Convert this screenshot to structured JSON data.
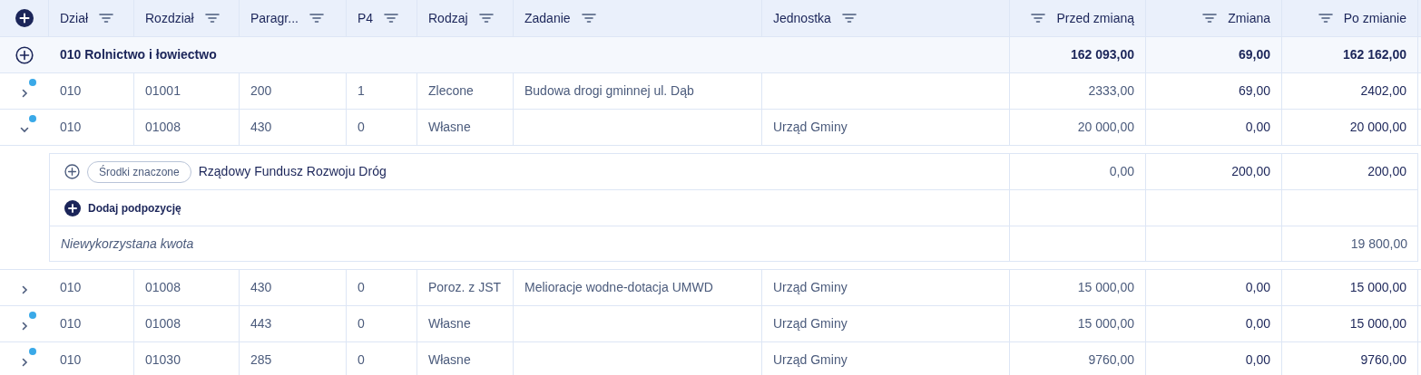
{
  "columns": [
    {
      "label": "Dział",
      "kind": "text"
    },
    {
      "label": "Rozdział",
      "kind": "text"
    },
    {
      "label": "Paragr...",
      "kind": "text"
    },
    {
      "label": "P4",
      "kind": "text"
    },
    {
      "label": "Rodzaj",
      "kind": "text"
    },
    {
      "label": "Zadanie",
      "kind": "text"
    },
    {
      "label": "Jednostka",
      "kind": "text"
    },
    {
      "label": "Przed zmianą",
      "kind": "amount"
    },
    {
      "label": "Zmiana",
      "kind": "amount"
    },
    {
      "label": "Po zmianie",
      "kind": "amount"
    }
  ],
  "group": {
    "label": "010 Rolnictwo i łowiectwo",
    "before": "162 093,00",
    "change": "69,00",
    "after": "162 162,00"
  },
  "rows": [
    {
      "expanded": false,
      "marked": true,
      "cells": [
        "010",
        "01001",
        "200",
        "1",
        "Zlecone",
        "Budowa drogi gminnej ul. Dąb",
        "",
        "2333,00",
        "69,00",
        "2402,00"
      ]
    },
    {
      "expanded": true,
      "marked": true,
      "cells": [
        "010",
        "01008",
        "430",
        "0",
        "Własne",
        "",
        "Urząd Gminy",
        "20 000,00",
        "0,00",
        "20 000,00"
      ],
      "details": {
        "items": [
          {
            "tag": "Środki znaczone",
            "name": "Rządowy Fundusz Rozwoju Dróg",
            "before": "0,00",
            "change": "200,00",
            "after": "200,00"
          }
        ],
        "add_label": "Dodaj podpozycję",
        "unused_label": "Niewykorzystana kwota",
        "unused_amount": "19 800,00"
      }
    },
    {
      "expanded": false,
      "marked": false,
      "cells": [
        "010",
        "01008",
        "430",
        "0",
        "Poroz. z JST",
        "Melioracje wodne-dotacja UMWD",
        "Urząd Gminy",
        "15 000,00",
        "0,00",
        "15 000,00"
      ]
    },
    {
      "expanded": false,
      "marked": true,
      "cells": [
        "010",
        "01008",
        "443",
        "0",
        "Własne",
        "",
        "Urząd Gminy",
        "15 000,00",
        "0,00",
        "15 000,00"
      ]
    },
    {
      "expanded": false,
      "marked": true,
      "cells": [
        "010",
        "01030",
        "285",
        "0",
        "Własne",
        "",
        "Urząd Gminy",
        "9760,00",
        "0,00",
        "9760,00"
      ]
    }
  ]
}
